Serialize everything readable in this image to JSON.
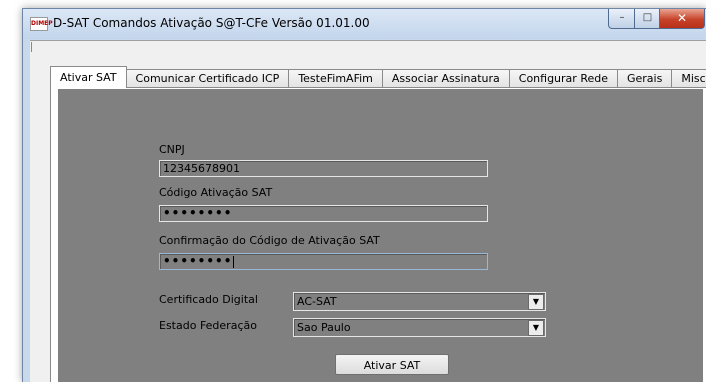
{
  "window": {
    "title": "D-SAT Comandos Ativação S@T-CFe Versão 01.01.00",
    "icon_label": "DIMEP"
  },
  "tabs": [
    {
      "label": "Ativar SAT",
      "active": true
    },
    {
      "label": "Comunicar Certificado ICP",
      "active": false
    },
    {
      "label": "TesteFimAFim",
      "active": false
    },
    {
      "label": "Associar Assinatura",
      "active": false
    },
    {
      "label": "Configurar Rede",
      "active": false
    },
    {
      "label": "Gerais",
      "active": false
    },
    {
      "label": "Miscelânea",
      "active": false
    }
  ],
  "form": {
    "cnpj_label": "CNPJ",
    "cnpj_value": "12345678901",
    "codigo_label": "Código Ativação SAT",
    "codigo_value": "••••••••",
    "confirmacao_label": "Confirmação do Código de Ativação SAT",
    "confirmacao_value": "••••••••",
    "certificado_label": "Certificado Digital",
    "certificado_value": "AC-SAT",
    "estado_label": "Estado Federação",
    "estado_value": "Sao Paulo",
    "submit_label": "Ativar SAT"
  },
  "icons": {
    "dropdown": "chevron-down-icon",
    "minimize": "minimize-icon",
    "maximize": "maximize-icon",
    "close": "close-icon"
  },
  "colors": {
    "content_background": "#808080",
    "close_button": "#c7432a",
    "titlebar": "#c9d9ec"
  }
}
